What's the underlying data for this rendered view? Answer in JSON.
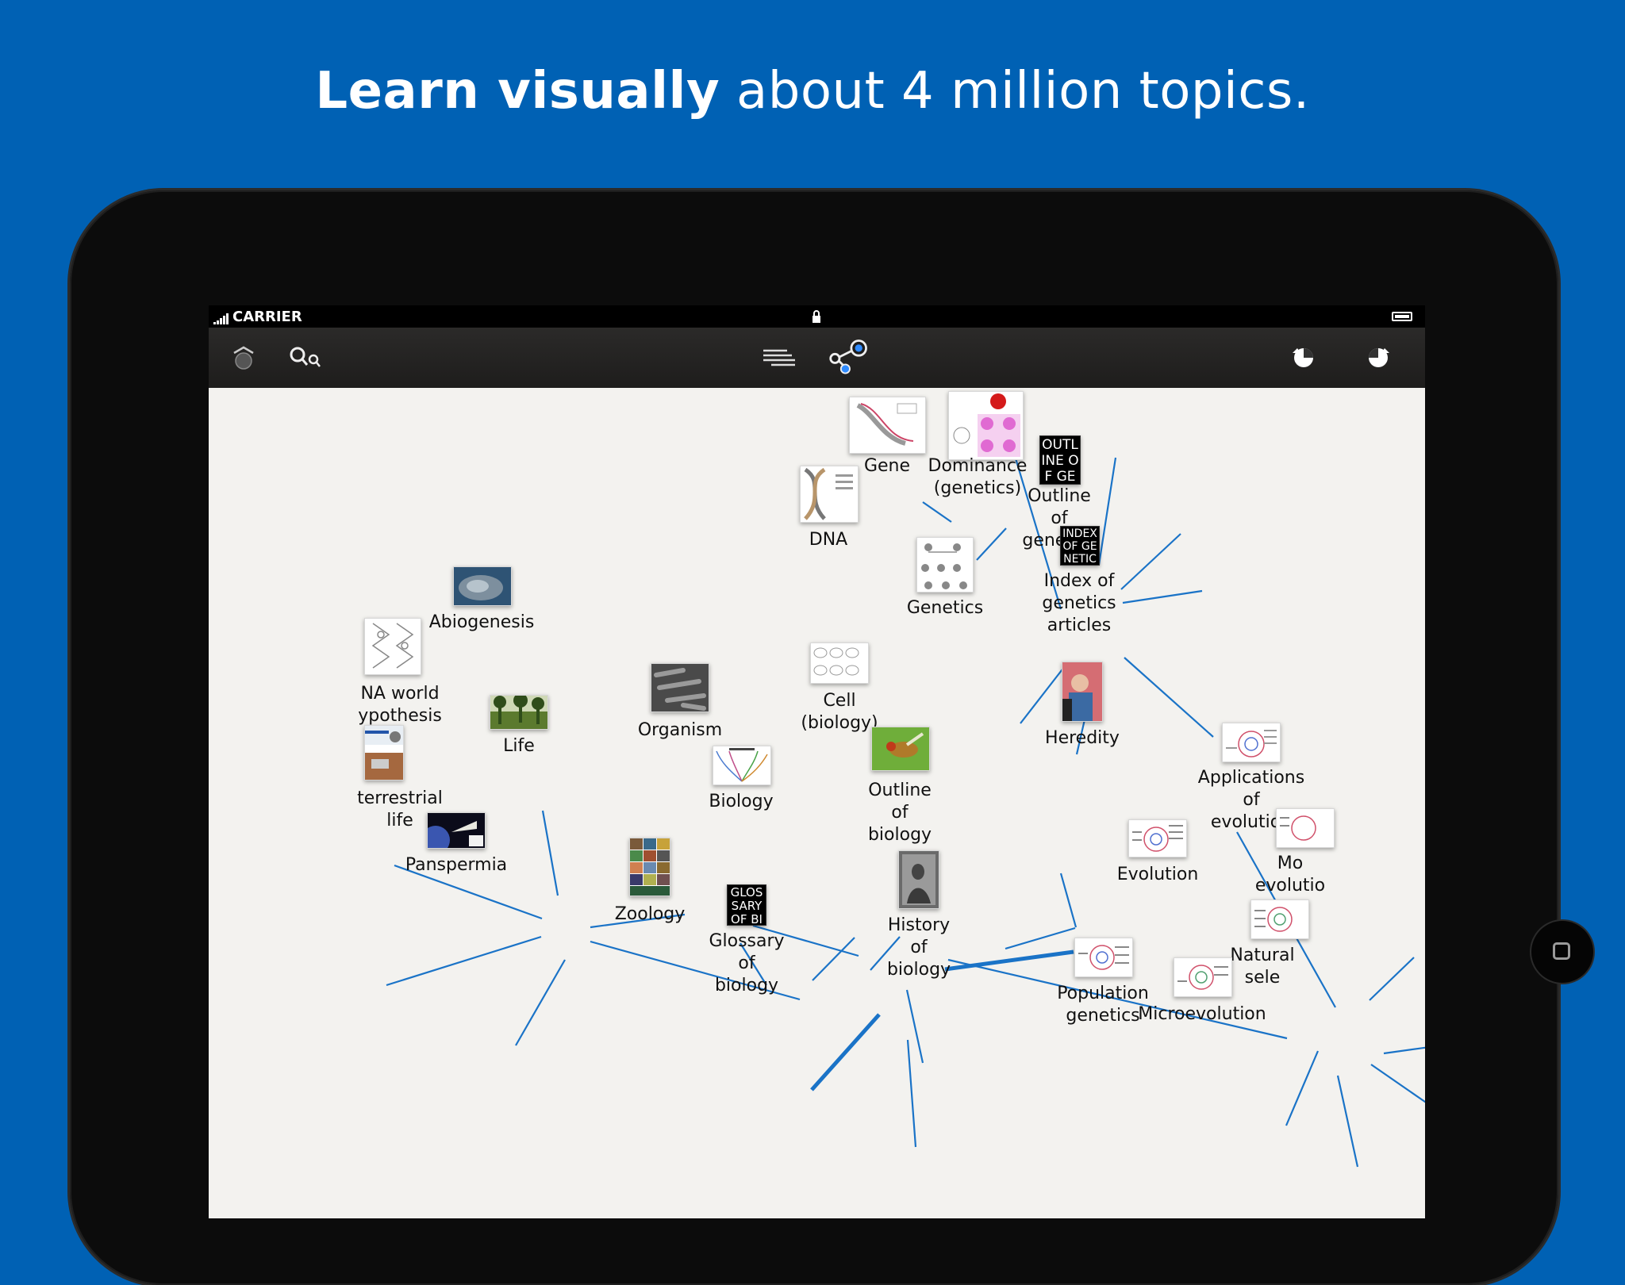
{
  "headline": {
    "bold": "Learn visually",
    "rest": " about 4 million topics."
  },
  "status": {
    "carrier": "CARRIER"
  },
  "toolbar": {
    "icons": [
      "home-icon",
      "search-icon",
      "list-view-icon",
      "graph-view-icon",
      "back-icon",
      "forward-icon"
    ]
  },
  "colors": {
    "background": "#0061b4",
    "edge": "#1a73c7",
    "canvas": "#f3f2ef"
  },
  "nodes": {
    "gene": {
      "label": "Gene"
    },
    "dominance": {
      "label": "Dominance\n(genetics)"
    },
    "outline_genetics": {
      "label": "Outline of\ngenetics",
      "thumb_text": "OUTLINE OF GENET"
    },
    "dna": {
      "label": "DNA"
    },
    "index_genetics": {
      "label": "Index of genetics\narticles",
      "thumb_text": "INDEX OF GENETICS"
    },
    "genetics": {
      "label": "Genetics"
    },
    "abiogenesis": {
      "label": "Abiogenesis"
    },
    "rna_world": {
      "label": "NA world\nypothesis"
    },
    "life": {
      "label": "Life"
    },
    "organism": {
      "label": "Organism"
    },
    "cell": {
      "label": "Cell (biology)"
    },
    "heredity": {
      "label": "Heredity"
    },
    "extraterrestrial": {
      "label": "terrestrial\nlife"
    },
    "biology": {
      "label": "Biology"
    },
    "outline_biology": {
      "label": "Outline of\nbiology"
    },
    "applications_evolution": {
      "label": "Applications of\nevolution"
    },
    "panspermia": {
      "label": "Panspermia"
    },
    "evolution": {
      "label": "Evolution"
    },
    "modern_evolution": {
      "label": "Mo\nevolutio"
    },
    "zoology": {
      "label": "Zoology"
    },
    "glossary": {
      "label": "Glossary of\nbiology",
      "thumb_text": "GLOSSARY OF BIOLO"
    },
    "history": {
      "label": "History of\nbiology"
    },
    "natural_selection": {
      "label": "Natural sele"
    },
    "population_genetics": {
      "label": "Population\ngenetics"
    },
    "microevolution": {
      "label": "Microevolution"
    }
  }
}
